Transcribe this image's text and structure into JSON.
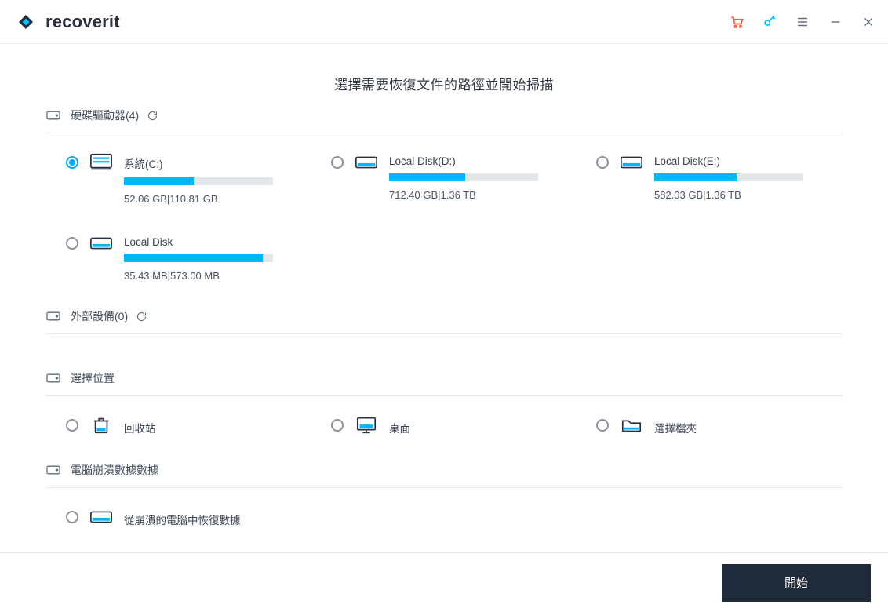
{
  "brand": {
    "name": "recoverit"
  },
  "page_title": "選擇需要恢復文件的路徑並開始掃描",
  "sections": {
    "hard_drives": {
      "title": "硬碟驅動器(4)",
      "items": [
        {
          "label": "系統(C:)",
          "stats": "52.06  GB|110.81  GB",
          "pct": 47,
          "selected": true,
          "icon": "system-drive"
        },
        {
          "label": "Local Disk(D:)",
          "stats": "712.40  GB|1.36  TB",
          "pct": 51,
          "selected": false,
          "icon": "drive"
        },
        {
          "label": "Local Disk(E:)",
          "stats": "582.03  GB|1.36  TB",
          "pct": 55,
          "selected": false,
          "icon": "drive"
        },
        {
          "label": "Local Disk",
          "stats": "35.43  MB|573.00  MB",
          "pct": 93,
          "selected": false,
          "icon": "drive"
        }
      ]
    },
    "external": {
      "title": "外部設備(0)"
    },
    "locations": {
      "title": "選擇位置",
      "items": [
        {
          "label": "回收站",
          "icon": "recycle-bin"
        },
        {
          "label": "桌面",
          "icon": "desktop"
        },
        {
          "label": "選擇檔夾",
          "icon": "folder"
        }
      ]
    },
    "crash": {
      "title": "電腦崩潰數據數據",
      "items": [
        {
          "label": "從崩潰的電腦中恢復數據",
          "icon": "drive"
        }
      ]
    }
  },
  "footer": {
    "start_label": "開始"
  },
  "colors": {
    "accent": "#00b5ff",
    "button_bg": "#1f2a3a",
    "cart": "#ff5a36"
  }
}
